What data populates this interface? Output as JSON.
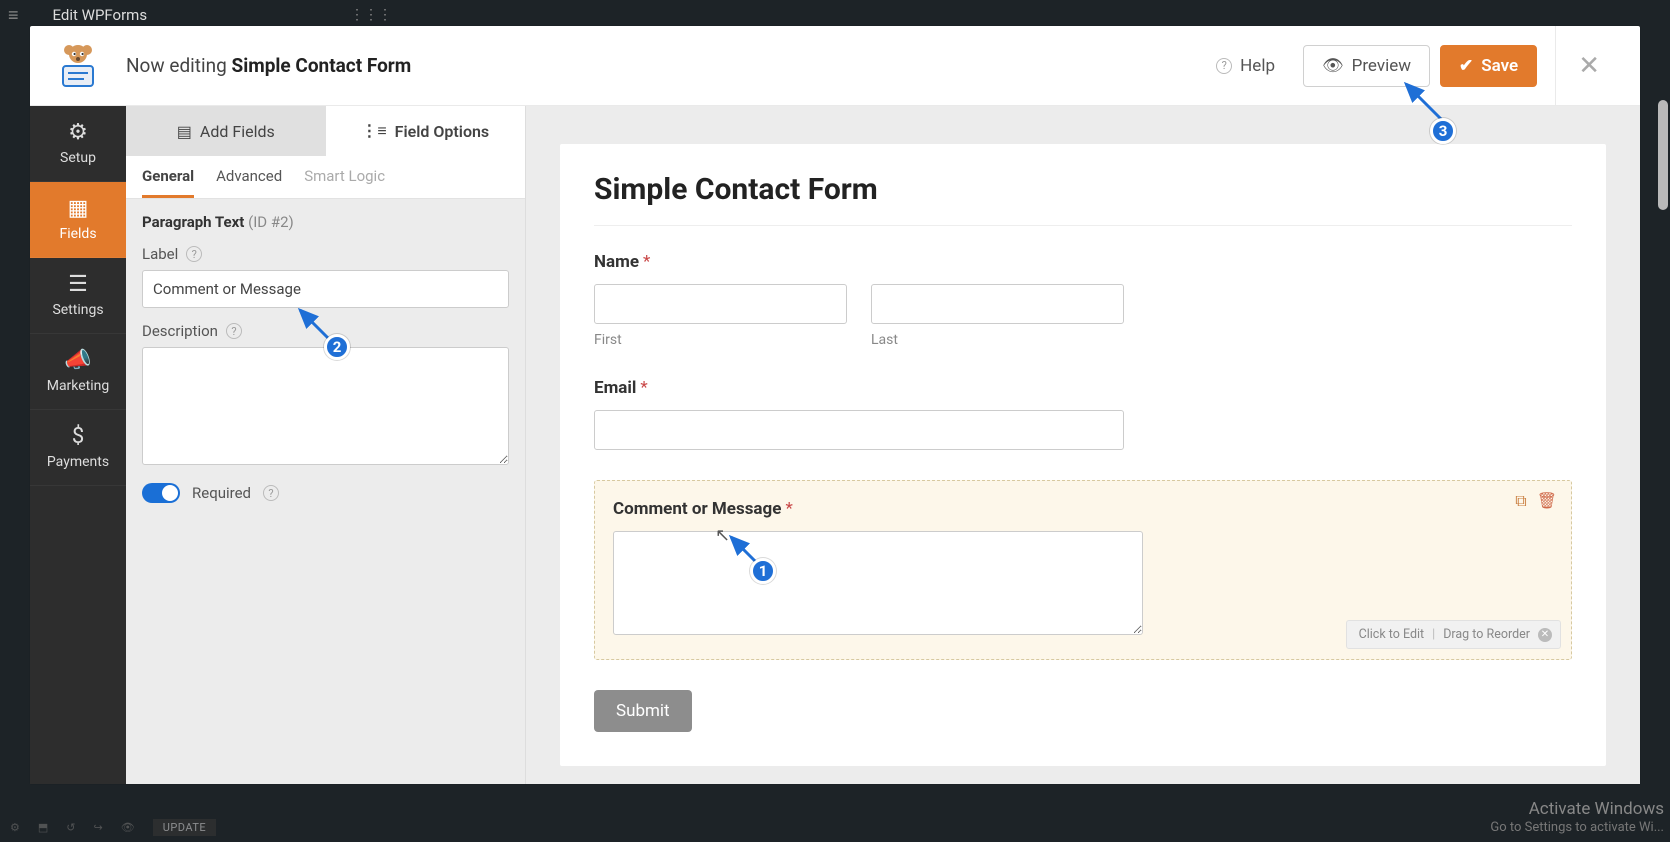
{
  "wp": {
    "page_title": "Edit WPForms",
    "update_btn": "UPDATE",
    "activate_heading": "Activate Windows",
    "activate_sub": "Go to Settings to activate Wi..."
  },
  "header": {
    "editing_prefix": "Now editing",
    "form_name": "Simple Contact Form",
    "help": "Help",
    "preview": "Preview",
    "save": "Save"
  },
  "rail": {
    "setup": "Setup",
    "fields": "Fields",
    "settings": "Settings",
    "marketing": "Marketing",
    "payments": "Payments"
  },
  "sidebar": {
    "tab_add": "Add Fields",
    "tab_options": "Field Options",
    "sub_general": "General",
    "sub_advanced": "Advanced",
    "sub_smart": "Smart Logic",
    "heading": "Paragraph Text",
    "heading_id": "(ID #2)",
    "label_label": "Label",
    "label_value": "Comment or Message",
    "desc_label": "Description",
    "desc_value": "",
    "required_label": "Required"
  },
  "preview": {
    "form_title": "Simple Contact Form",
    "name_label": "Name",
    "first": "First",
    "last": "Last",
    "email_label": "Email",
    "comment_label": "Comment or Message",
    "submit_label": "Submit",
    "hint_edit": "Click to Edit",
    "hint_reorder": "Drag to Reorder"
  },
  "annotations": {
    "n1": "1",
    "n2": "2",
    "n3": "3"
  }
}
